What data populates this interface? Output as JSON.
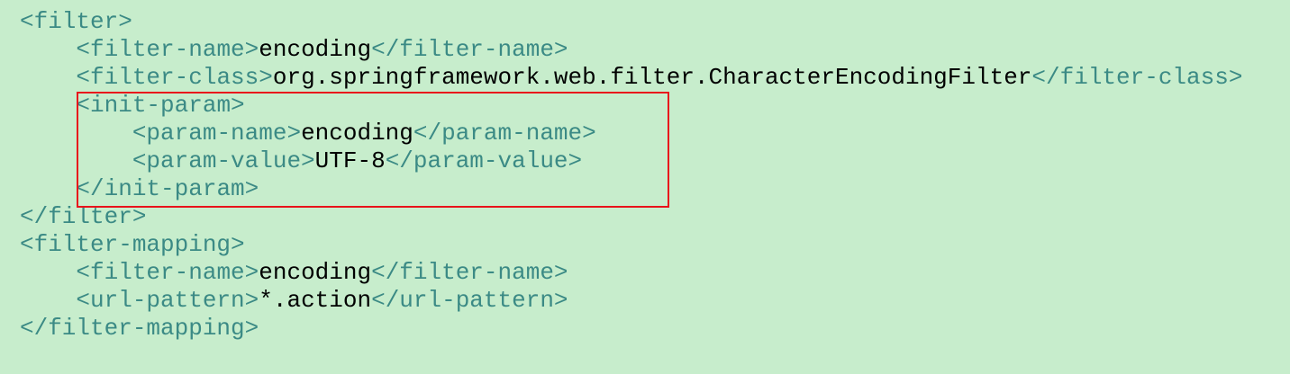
{
  "code": {
    "lines": [
      {
        "indent": "",
        "open": "<filter>",
        "text": "",
        "close": ""
      },
      {
        "indent": "    ",
        "open": "<filter-name>",
        "text": "encoding",
        "close": "</filter-name>"
      },
      {
        "indent": "    ",
        "open": "<filter-class>",
        "text": "org.springframework.web.filter.CharacterEncodingFilter",
        "close": "</filter-class>"
      },
      {
        "indent": "    ",
        "open": "<init-param>",
        "text": "",
        "close": ""
      },
      {
        "indent": "        ",
        "open": "<param-name>",
        "text": "encoding",
        "close": "</param-name>"
      },
      {
        "indent": "        ",
        "open": "<param-value>",
        "text": "UTF-8",
        "close": "</param-value>"
      },
      {
        "indent": "    ",
        "open": "</init-param>",
        "text": "",
        "close": ""
      },
      {
        "indent": "",
        "open": "</filter>",
        "text": "",
        "close": ""
      },
      {
        "indent": "",
        "open": "<filter-mapping>",
        "text": "",
        "close": ""
      },
      {
        "indent": "    ",
        "open": "<filter-name>",
        "text": "encoding",
        "close": "</filter-name>"
      },
      {
        "indent": "    ",
        "open": "<url-pattern>",
        "text": "*.action",
        "close": "</url-pattern>"
      },
      {
        "indent": "",
        "open": "</filter-mapping>",
        "text": "",
        "close": ""
      }
    ]
  },
  "colors": {
    "background": "#c7edcc",
    "tag": "#3b8a85",
    "text": "#000000",
    "highlight_border": "#e8131b"
  }
}
